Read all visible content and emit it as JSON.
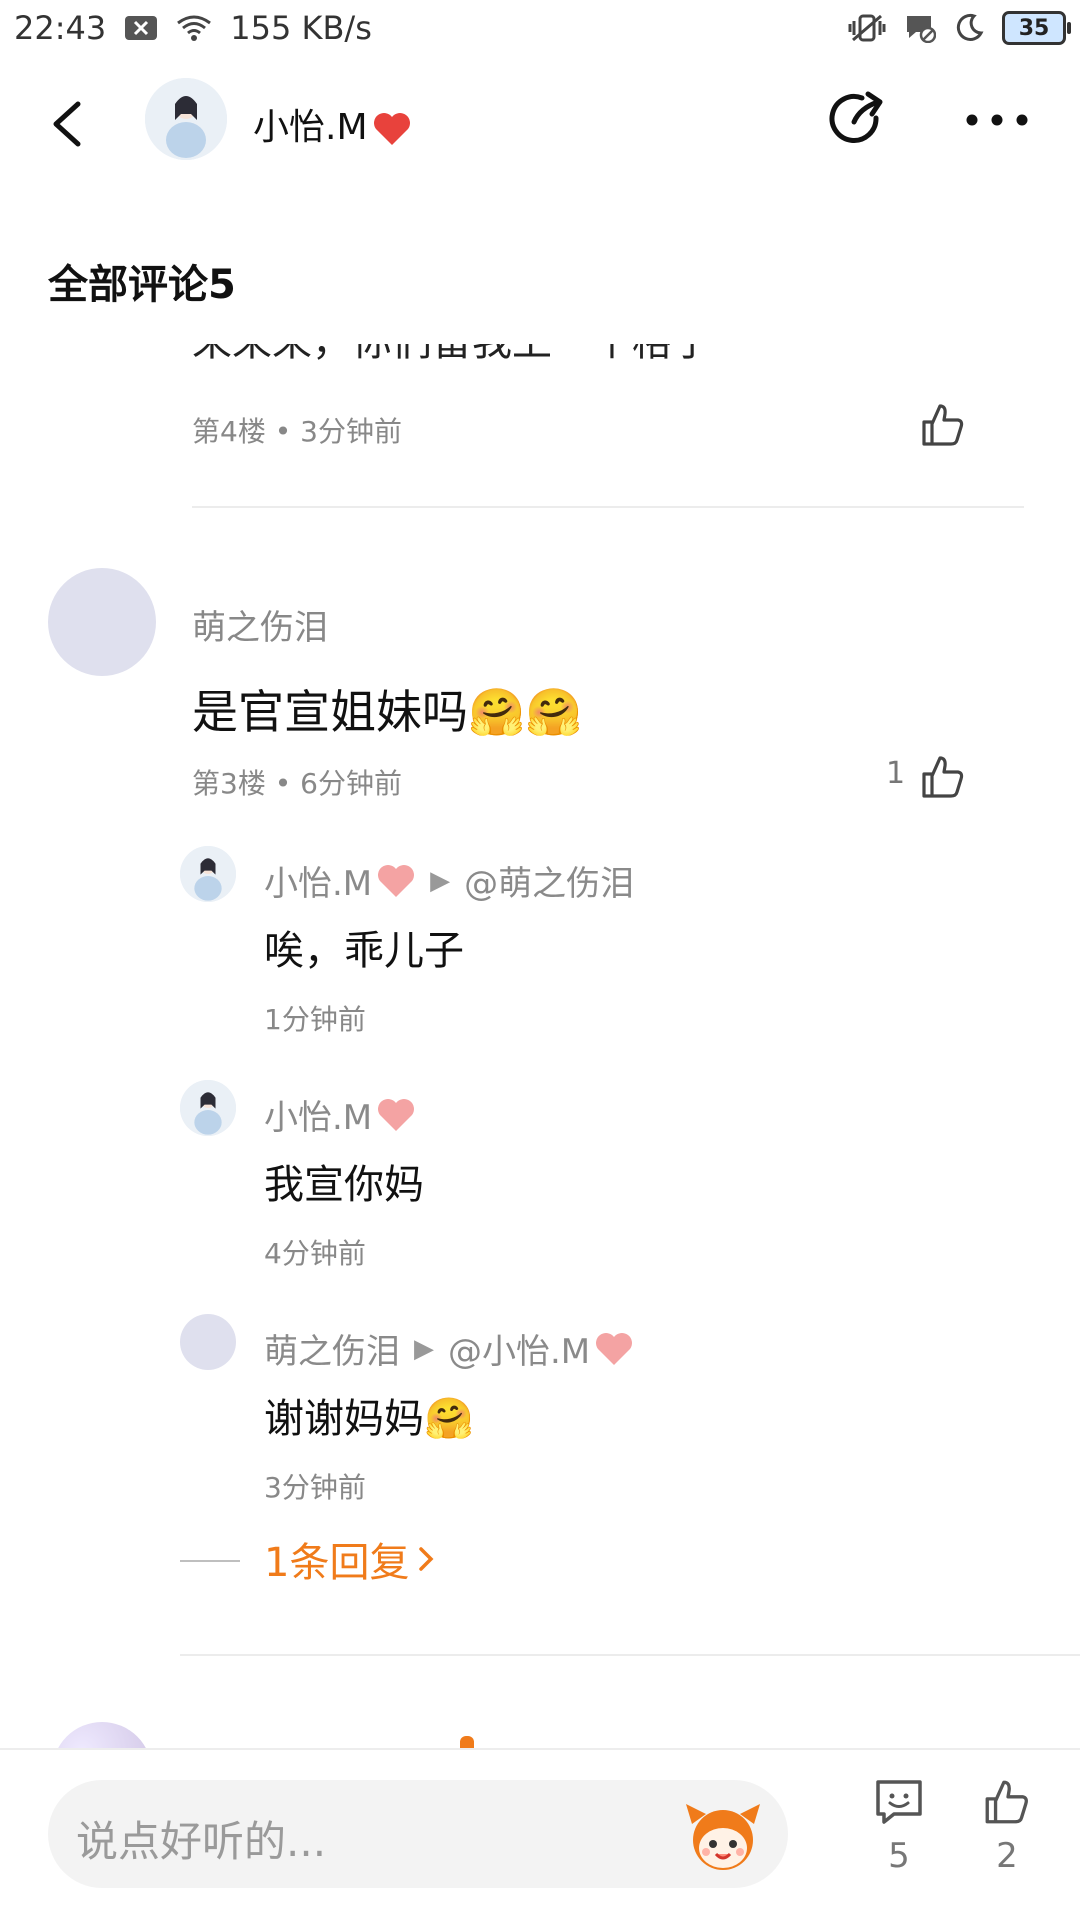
{
  "status_bar": {
    "time": "22:43",
    "network_speed": "155 KB/s",
    "battery_level": "35"
  },
  "header": {
    "username": "小怡.M",
    "icons": [
      "back-arrow-icon",
      "share-icon",
      "more-dots-icon"
    ],
    "heart_color": "#e8423c"
  },
  "section": {
    "title": "全部评论5"
  },
  "comments": [
    {
      "clipped_text": "来来来，你们留我上一个格子",
      "floor": "第4楼 • 3分钟前"
    },
    {
      "username": "萌之伤泪",
      "text": "是官宣姐妹吗🤗🤗",
      "floor": "第3楼 • 6分钟前",
      "likes": "1",
      "replies": [
        {
          "from": "小怡.M",
          "to": "@萌之伤泪",
          "text": "唉，乖儿子",
          "time": "1分钟前"
        },
        {
          "from": "小怡.M",
          "to": "",
          "text": "我宣你妈",
          "time": "4分钟前"
        },
        {
          "from": "萌之伤泪",
          "to": "@小怡.M",
          "text": "谢谢妈妈🤗",
          "time": "3分钟前"
        }
      ],
      "more_replies_label": "1条回复"
    }
  ],
  "bottom_bar": {
    "input_placeholder": "说点好听的...",
    "comment_count": "5",
    "like_count": "2"
  },
  "colors": {
    "accent_orange": "#f07b1a",
    "meta_gray": "#888888",
    "heart_pink": "#f4a3a3"
  }
}
